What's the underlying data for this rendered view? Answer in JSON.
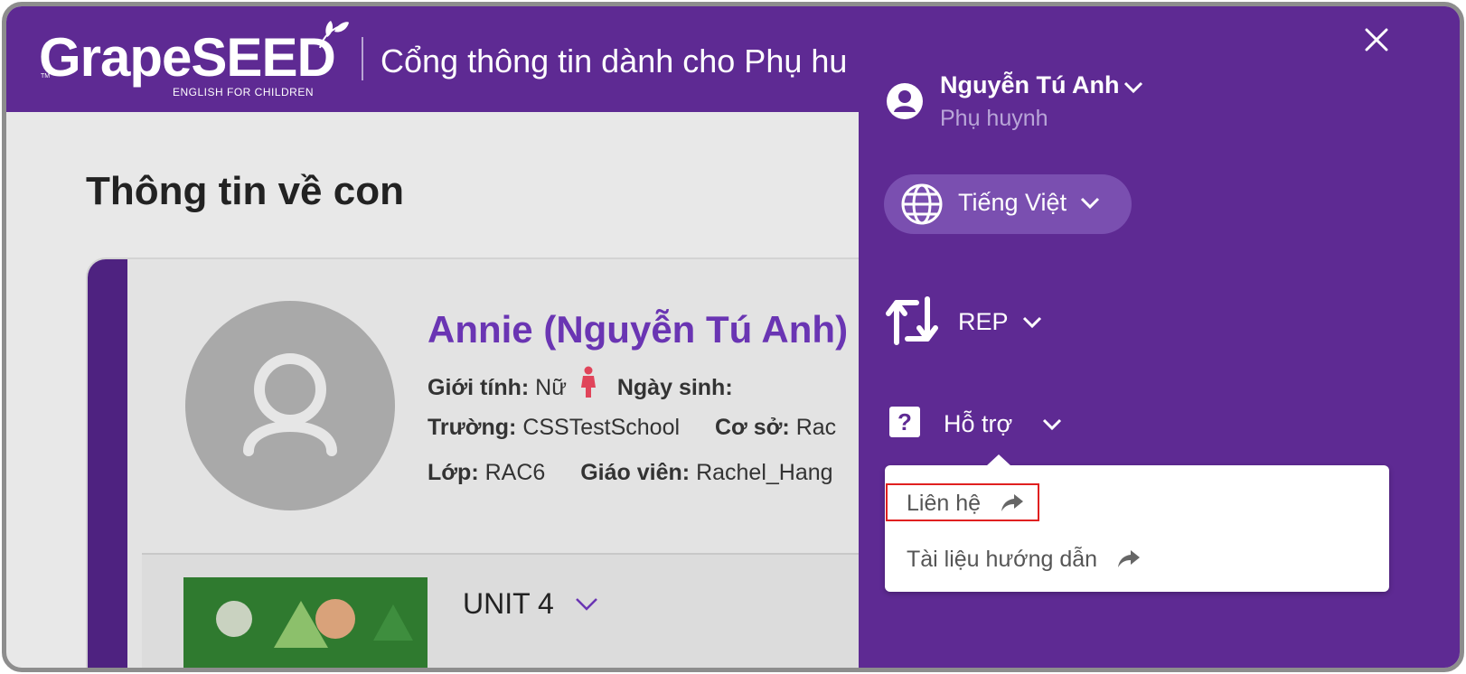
{
  "header": {
    "logo_text": "GrapeSEED",
    "logo_subtitle": "ENGLISH FOR CHILDREN",
    "logo_tm": "TM",
    "title": "Cổng thông tin dành cho Phụ hu"
  },
  "main": {
    "page_title": "Thông tin về con",
    "student": {
      "name": "Annie (Nguyễn Tú Anh)",
      "gender_label": "Giới tính:",
      "gender_value": "Nữ",
      "birthday_label": "Ngày sinh:",
      "school_label": "Trường:",
      "school_value": "CSSTestSchool",
      "campus_label": "Cơ sở:",
      "campus_value": "Rac",
      "class_label": "Lớp:",
      "class_value": "RAC6",
      "teacher_label": "Giáo viên:",
      "teacher_value": "Rachel_Hang"
    },
    "unit": {
      "label": "UNIT 4"
    }
  },
  "panel": {
    "user": {
      "name": "Nguyễn Tú Anh",
      "role": "Phụ huynh"
    },
    "language": {
      "label": "Tiếng Việt"
    },
    "rep": {
      "label": "REP"
    },
    "help": {
      "label": "Hỗ trợ",
      "items": [
        {
          "label": "Liên hệ"
        },
        {
          "label": "Tài liệu hướng dẫn"
        }
      ]
    }
  },
  "colors": {
    "brand_purple": "#5e2a93",
    "pill_purple": "#7a4fb0",
    "name_purple": "#6a35b3",
    "highlight_red": "#e02020"
  },
  "icons": [
    "close-icon",
    "user-circle-icon",
    "chevron-down-icon",
    "globe-icon",
    "swap-icon",
    "question-icon",
    "share-arrow-icon",
    "person-icon",
    "female-icon"
  ]
}
